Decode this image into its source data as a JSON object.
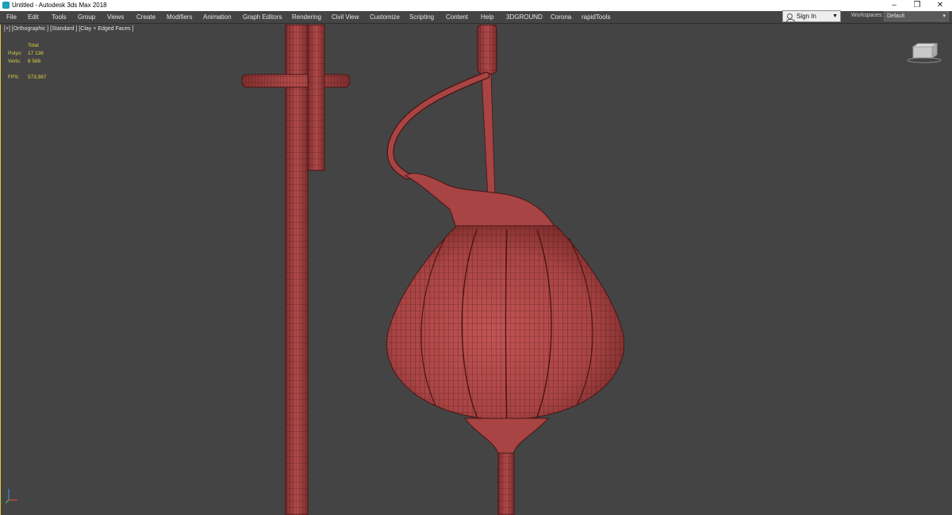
{
  "window": {
    "title": "Untitled - Autodesk 3ds Max 2018",
    "buttons": {
      "minimize": "–",
      "restore": "❐",
      "close": "✕"
    }
  },
  "menubar": {
    "items": [
      {
        "label": "File"
      },
      {
        "label": "Edit"
      },
      {
        "label": "Tools"
      },
      {
        "label": "Group"
      },
      {
        "label": "Views"
      },
      {
        "label": "Create"
      },
      {
        "label": "Modifiers"
      },
      {
        "label": "Animation"
      },
      {
        "label": "Graph Editors"
      },
      {
        "label": "Rendering"
      },
      {
        "label": "Civil View"
      },
      {
        "label": "Customize"
      },
      {
        "label": "Scripting"
      },
      {
        "label": "Content"
      },
      {
        "label": "Help"
      },
      {
        "label": "3DGROUND"
      },
      {
        "label": "Corona"
      },
      {
        "label": "rapidTools"
      }
    ],
    "sign_in": "Sign In",
    "workspaces_label": "Workspaces:",
    "workspace_value": "Default"
  },
  "viewport": {
    "label": "[+] [Orthographic ] [Standard ] [Clay + Edged Faces ]",
    "stats": {
      "header": "Total",
      "polys_label": "Polys:",
      "polys_value": "17 136",
      "verts_label": "Verts:",
      "verts_value": "8 588",
      "fps_label": "FPS:",
      "fps_value": "573,987"
    }
  },
  "colors": {
    "background": "#444444",
    "clay": "#a84444",
    "wire": "#4a1414",
    "stats_text": "#e0d040"
  },
  "icons": {
    "app": "3dsmax-app-icon",
    "user": "user-icon",
    "viewcube": "viewcube-icon",
    "axis": "axis-tripod-icon"
  }
}
